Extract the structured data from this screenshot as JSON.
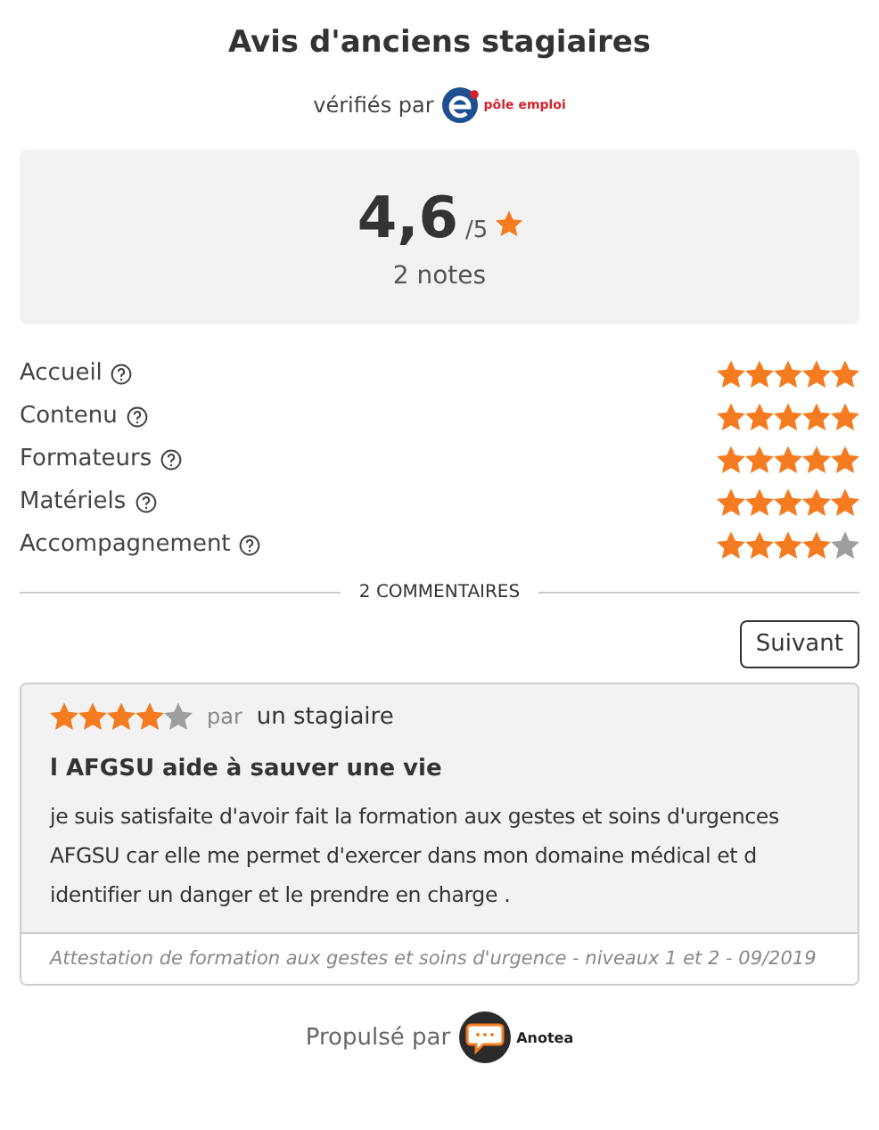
{
  "title": "Avis d'anciens stagiaires",
  "verified": {
    "label": "vérifiés par",
    "logo_text": "pôle emploi"
  },
  "summary": {
    "score": "4,6",
    "scale": "/5",
    "count": "2 notes"
  },
  "criteria": [
    {
      "label": "Accueil",
      "stars": 5
    },
    {
      "label": "Contenu",
      "stars": 5
    },
    {
      "label": "Formateurs",
      "stars": 5
    },
    {
      "label": "Matériels",
      "stars": 5
    },
    {
      "label": "Accompagnement",
      "stars": 4
    }
  ],
  "comments_heading": "2 COMMENTAIRES",
  "next_button": "Suivant",
  "comment": {
    "stars": 4,
    "by": "par",
    "author": "un stagiaire",
    "title": "l AFGSU aide à sauver une vie",
    "text": "je suis satisfaite d'avoir fait la formation aux gestes et soins d'urgences AFGSU car elle me permet d'exercer dans mon domaine médical et d identifier un danger et le prendre en charge .",
    "footer": "Attestation de formation aux gestes et soins d'urgence - niveaux 1 et 2 - 09/2019"
  },
  "powered": {
    "label": "Propulsé par",
    "logo_text": "Anotea"
  }
}
